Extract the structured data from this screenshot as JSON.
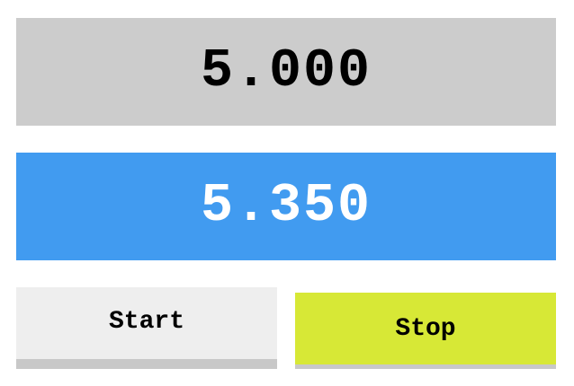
{
  "target": {
    "value": "5.000"
  },
  "timer": {
    "value": "5.350"
  },
  "controls": {
    "start_label": "Start",
    "stop_label": "Stop"
  },
  "colors": {
    "target_bg": "#cccccc",
    "timer_bg": "#419bf0",
    "start_bg": "#eeeeee",
    "stop_bg": "#d7e836"
  }
}
